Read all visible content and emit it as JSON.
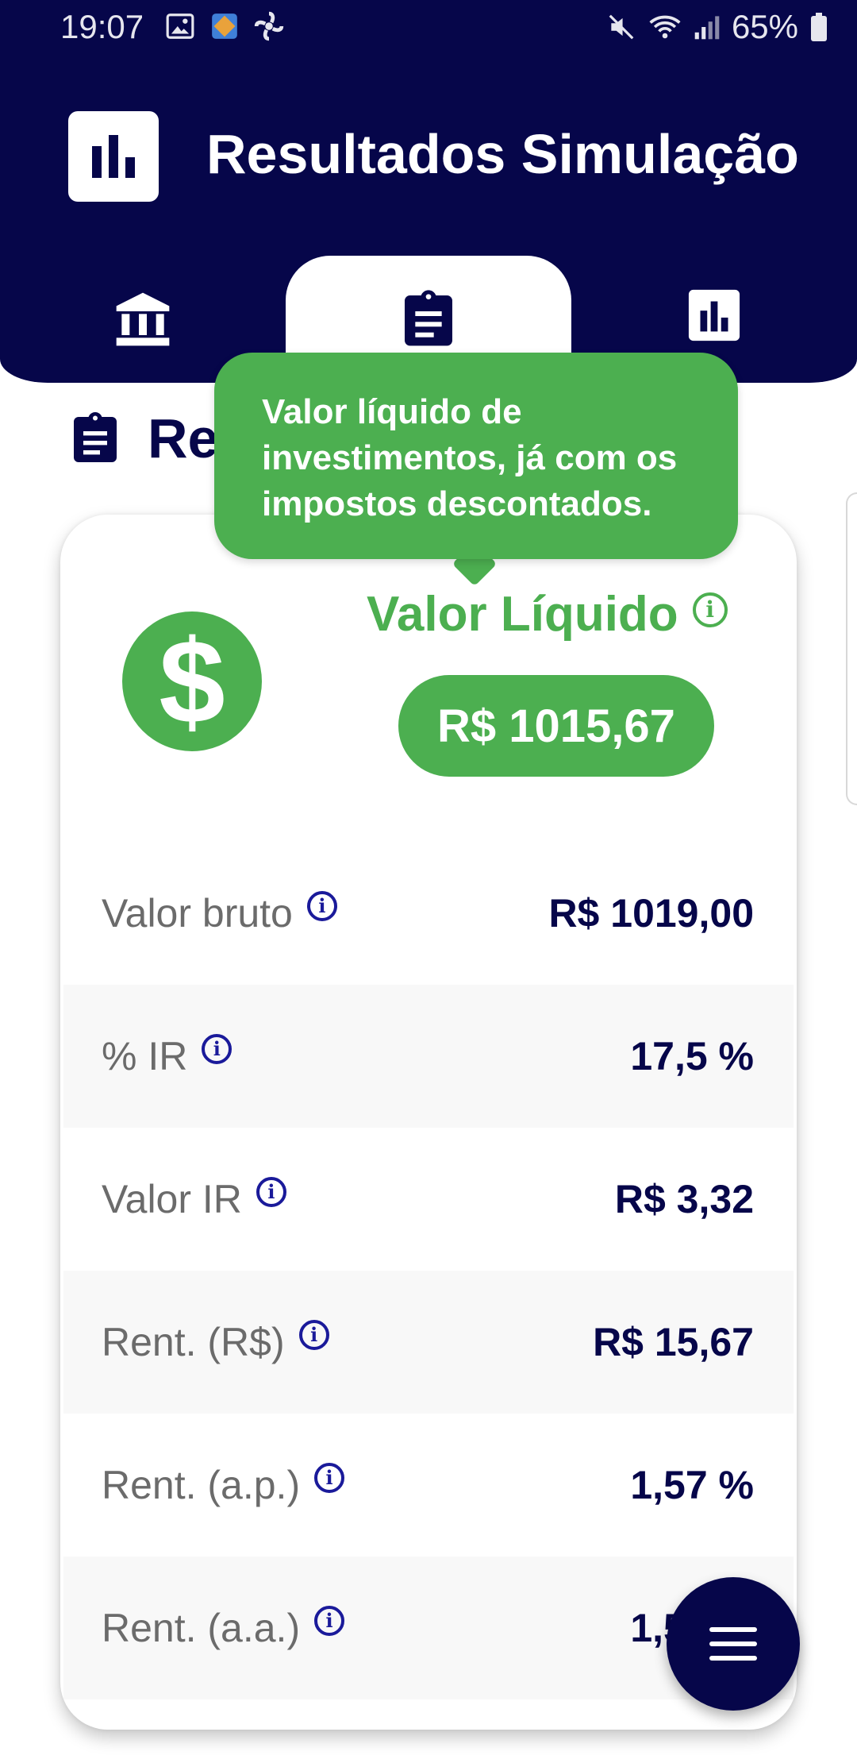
{
  "status_bar": {
    "time": "19:07",
    "battery": "65%"
  },
  "header": {
    "title": "Resultados Simulação"
  },
  "tabs": [
    {
      "name": "bank",
      "icon": "bank-icon"
    },
    {
      "name": "summary",
      "icon": "clipboard-icon",
      "active": true
    },
    {
      "name": "chart",
      "icon": "bar-chart-icon"
    }
  ],
  "section": {
    "title": "Resumo"
  },
  "tooltip": {
    "text": "Valor líquido de investimentos, já com os impostos descontados."
  },
  "net": {
    "label": "Valor Líquido",
    "value": "R$ 1015,67"
  },
  "rows": [
    {
      "label": "Valor bruto",
      "value": "R$ 1019,00"
    },
    {
      "label": "% IR",
      "value": "17,5 %"
    },
    {
      "label": "Valor IR",
      "value": "R$ 3,32"
    },
    {
      "label": "Rent. (R$)",
      "value": "R$ 15,67"
    },
    {
      "label": "Rent. (a.p.)",
      "value": "1,57 %"
    },
    {
      "label": "Rent. (a.a.)",
      "value": "1,57 %"
    }
  ],
  "colors": {
    "primary": "#06064a",
    "accent": "#4caf50",
    "info": "#1a1a9a"
  }
}
